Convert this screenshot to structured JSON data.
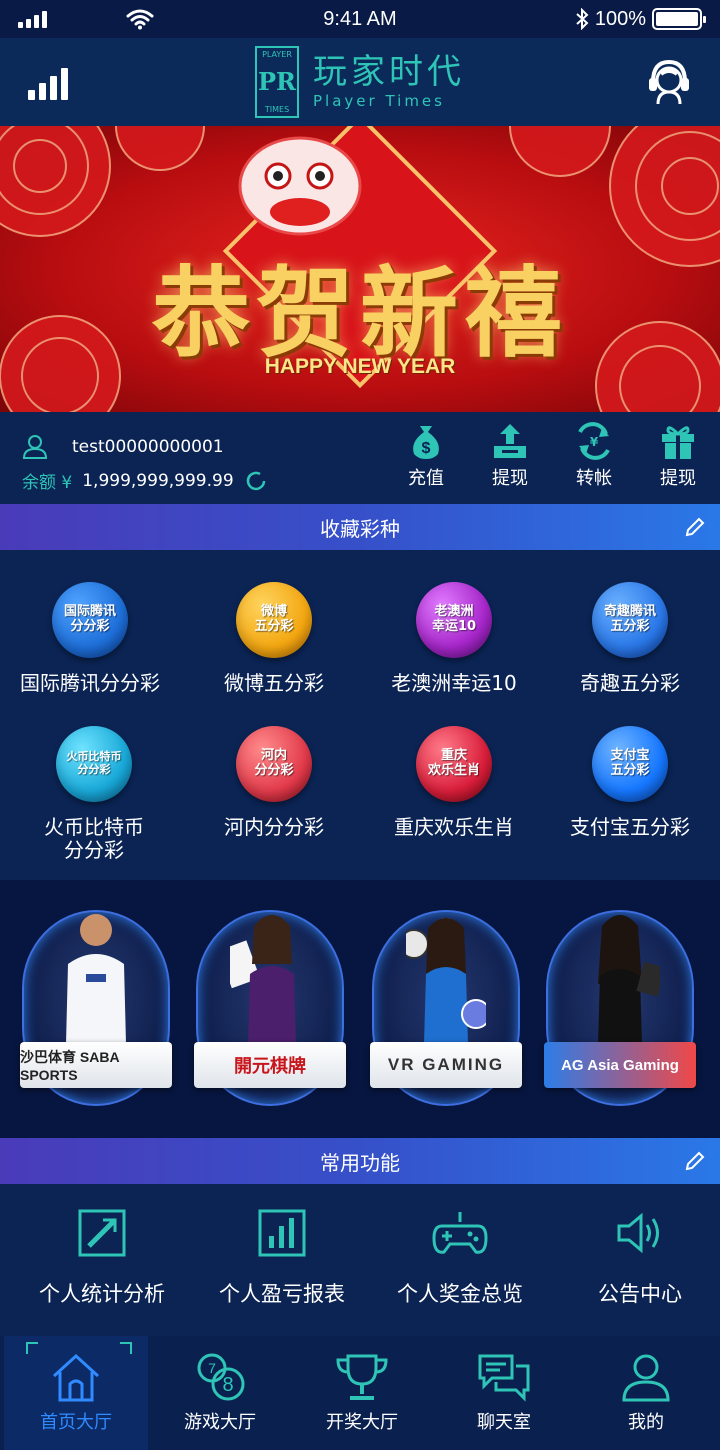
{
  "status_bar": {
    "time": "9:41 AM",
    "battery": "100%"
  },
  "header": {
    "brand_cn": "玩家时代",
    "brand_en": "Player Times",
    "logo_top": "PLAYER",
    "logo_mark": "PR",
    "logo_bottom": "TIMES"
  },
  "banner": {
    "title": "恭贺新禧",
    "subtitle": "HAPPY NEW YEAR"
  },
  "account": {
    "username": "test00000000001",
    "balance_label": "余额 ¥",
    "balance": "1,999,999,999.99",
    "actions": [
      {
        "label": "充值",
        "icon": "money-bag-icon"
      },
      {
        "label": "提现",
        "icon": "upload-tray-icon"
      },
      {
        "label": "转帐",
        "icon": "transfer-icon"
      },
      {
        "label": "提现",
        "icon": "gift-icon"
      }
    ]
  },
  "favorites": {
    "title": "收藏彩种",
    "items": [
      {
        "name": "国际腾讯分分彩",
        "badge": "国际腾讯\n分分彩",
        "color": "#1e6fd9"
      },
      {
        "name": "微博五分彩",
        "badge": "微博\n五分彩",
        "color": "#f3a712"
      },
      {
        "name": "老澳洲幸运10",
        "badge": "老澳洲\n幸运10",
        "color": "#a626c9"
      },
      {
        "name": "奇趣五分彩",
        "badge": "奇趣腾讯\n五分彩",
        "color": "#2a78e8"
      },
      {
        "name": "火币比特币\n分分彩",
        "badge": "火币比特币\n分分彩",
        "color": "#19a9d8"
      },
      {
        "name": "河内分分彩",
        "badge": "河内\n分分彩",
        "color": "#e23b4b"
      },
      {
        "name": "重庆欢乐生肖",
        "badge": "重庆\n欢乐生肖",
        "color": "#d91e3a"
      },
      {
        "name": "支付宝五分彩",
        "badge": "支付宝\n五分彩",
        "color": "#1677ff"
      }
    ]
  },
  "platforms": [
    {
      "name": "沙巴体育 SABA SPORTS"
    },
    {
      "name": "開元棋牌"
    },
    {
      "name": "VR GAMING"
    },
    {
      "name": "AG Asia Gaming"
    }
  ],
  "functions": {
    "title": "常用功能",
    "items": [
      {
        "label": "个人统计分析",
        "icon": "chart-up-icon"
      },
      {
        "label": "个人盈亏报表",
        "icon": "bar-report-icon"
      },
      {
        "label": "个人奖金总览",
        "icon": "gamepad-icon"
      },
      {
        "label": "公告中心",
        "icon": "speaker-icon"
      }
    ]
  },
  "tabs": [
    {
      "label": "首页大厅",
      "icon": "home-icon",
      "active": true
    },
    {
      "label": "游戏大厅",
      "icon": "lottery-balls-icon",
      "active": false
    },
    {
      "label": "开奖大厅",
      "icon": "trophy-icon",
      "active": false
    },
    {
      "label": "聊天室",
      "icon": "chat-icon",
      "active": false
    },
    {
      "label": "我的",
      "icon": "user-icon",
      "active": false
    }
  ],
  "colors": {
    "teal": "#2ec4b6",
    "page_bg": "#0b1c4e",
    "active_tab": "#2f8bff"
  }
}
